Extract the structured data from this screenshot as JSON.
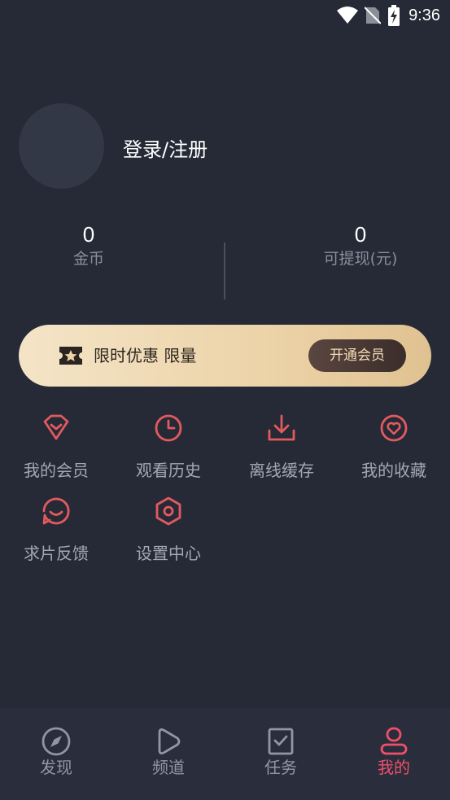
{
  "status_bar": {
    "time": "9:36",
    "icons": [
      "wifi-icon",
      "no-sim-icon",
      "battery-charging-icon"
    ]
  },
  "profile": {
    "login_label": "登录/注册"
  },
  "stats": {
    "coins": {
      "value": "0",
      "label": "金币"
    },
    "withdrawable": {
      "value": "0",
      "label": "可提现(元)"
    }
  },
  "vip_banner": {
    "icon": "ticket-star-icon",
    "text": "限时优惠 限量",
    "button_label": "开通会员"
  },
  "menu": [
    {
      "label": "我的会员",
      "icon": "diamond-icon"
    },
    {
      "label": "观看历史",
      "icon": "clock-icon"
    },
    {
      "label": "离线缓存",
      "icon": "download-icon"
    },
    {
      "label": "我的收藏",
      "icon": "heart-icon"
    },
    {
      "label": "求片反馈",
      "icon": "feedback-bubble-icon"
    },
    {
      "label": "设置中心",
      "icon": "settings-hexagon-icon"
    }
  ],
  "bottom_nav": [
    {
      "label": "发现",
      "icon": "compass-icon",
      "active": false
    },
    {
      "label": "频道",
      "icon": "play-icon",
      "active": false
    },
    {
      "label": "任务",
      "icon": "task-icon",
      "active": false
    },
    {
      "label": "我的",
      "icon": "user-icon",
      "active": true
    }
  ],
  "colors": {
    "background": "#262a37",
    "accent": "#ef4f6b",
    "menu_icon": "#e25a5e",
    "vip_gold": "#ecd3a8"
  }
}
